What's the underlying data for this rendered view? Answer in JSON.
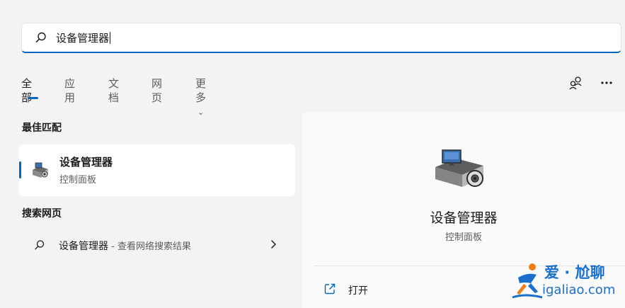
{
  "search": {
    "query": "设备管理器"
  },
  "tabs": [
    {
      "label": "全部"
    },
    {
      "label": "应用"
    },
    {
      "label": "文档"
    },
    {
      "label": "网页"
    },
    {
      "label": "更多"
    }
  ],
  "best_match": {
    "section_title": "最佳匹配",
    "name": "设备管理器",
    "subtitle": "控制面板"
  },
  "web_search": {
    "section_title": "搜索网页",
    "query": "设备管理器",
    "suffix": " - 查看网络搜索结果"
  },
  "detail": {
    "title": "设备管理器",
    "subtitle": "控制面板",
    "actions": [
      {
        "label": "打开"
      }
    ]
  },
  "watermark": {
    "line1": "爱 · 尬聊",
    "line2": "igaliao.com"
  },
  "colors": {
    "accent": "#0067c0",
    "background": "#f3f3f3",
    "watermark": "#1a6fce"
  }
}
